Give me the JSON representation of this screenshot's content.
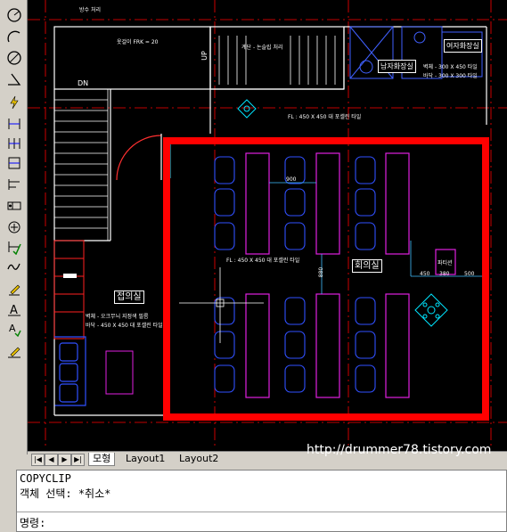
{
  "toolbar": {
    "tools": [
      "circle-icon",
      "arc-icon",
      "ellipse-icon",
      "angle-dimension-icon",
      "lightning-icon",
      "dimension-linear-icon",
      "dimension-aligned-icon",
      "dimension-continue-icon",
      "dimension-baseline-icon",
      "tolerance-icon",
      "center-mark-icon",
      "dimension-edit-icon",
      "dimension-text-edit-icon",
      "pencil-icon",
      "text-style-icon",
      "update-dimension-icon",
      "edit-pencil-icon"
    ]
  },
  "drawing": {
    "labels": {
      "top_note": "방수 처리",
      "closet_note": "옷걸이 FRK = 20",
      "stair_dn": "DN",
      "up": "UP",
      "stair_right_note": "계단 - 논슬립 처리",
      "fl_top": "FL : 450 X 450 대 포셀린 타일",
      "fl_center": "FL : 450 X 450 대 포셀린 타일",
      "restroom_note1": "벽체 - 300 X 450 타일",
      "restroom_note2": "바닥 - 300 X 300 타일",
      "left_room_note1": "벽체 - 오크무늬 지정색 필름",
      "left_room_note2": "바닥 - 450 X 450 대 포셀린 타일",
      "dim_center": "900",
      "dim_a": "450",
      "dim_b": "380",
      "dim_c": "500",
      "dim_vertical": "880",
      "small_label": "파티션"
    },
    "rooms": {
      "meeting_left": "접의실",
      "meeting_main": "회의실",
      "restroom_men": "남자화장실",
      "restroom_women": "여자화장실"
    },
    "highlight_color": "#ff0000"
  },
  "tabs": {
    "nav": [
      "|◀",
      "◀",
      "▶",
      "▶|"
    ],
    "items": [
      "모형",
      "Layout1",
      "Layout2"
    ],
    "active": "모형"
  },
  "watermark": "http://drummer78.tistory.com",
  "command": {
    "history_line1": "COPYCLIP",
    "history_line2": "객체 선택: *취소*",
    "prompt": "명령:"
  }
}
